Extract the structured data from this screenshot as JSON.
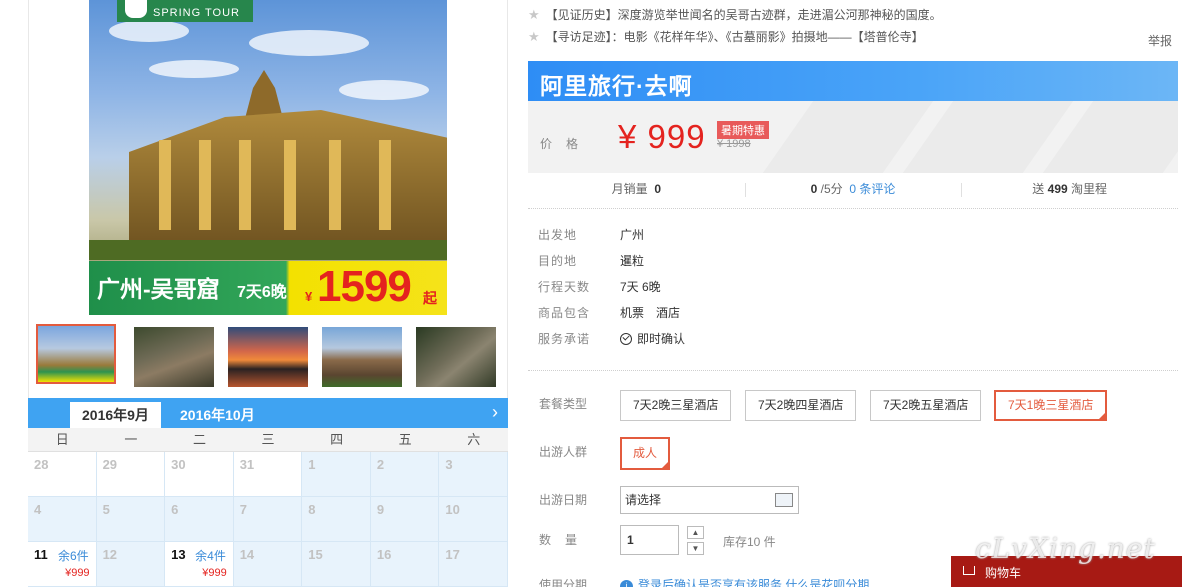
{
  "hero": {
    "logo_text": "SPRING TOUR",
    "banner_title": "广州-吴哥窟",
    "banner_sub": "7天6晚",
    "banner_yen": "¥",
    "banner_price": "1599",
    "banner_suffix": "起"
  },
  "thumbnails": [
    "thumb-1",
    "thumb-2",
    "thumb-3",
    "thumb-4",
    "thumb-5"
  ],
  "calendar": {
    "tab_current": "2016年9月",
    "tab_next": "2016年10月",
    "weekdays": [
      "日",
      "一",
      "二",
      "三",
      "四",
      "五",
      "六"
    ],
    "rows": [
      [
        {
          "d": "28"
        },
        {
          "d": "29"
        },
        {
          "d": "30"
        },
        {
          "d": "31"
        },
        {
          "d": "1"
        },
        {
          "d": "2"
        },
        {
          "d": "3"
        }
      ],
      [
        {
          "d": "4"
        },
        {
          "d": "5"
        },
        {
          "d": "6"
        },
        {
          "d": "7"
        },
        {
          "d": "8"
        },
        {
          "d": "9"
        },
        {
          "d": "10"
        }
      ],
      [
        {
          "d": "11",
          "left": "余6件",
          "price": "¥999"
        },
        {
          "d": "12"
        },
        {
          "d": "13",
          "left": "余4件",
          "price": "¥999"
        },
        {
          "d": "14"
        },
        {
          "d": "15"
        },
        {
          "d": "16"
        },
        {
          "d": "17"
        }
      ]
    ]
  },
  "highlights": [
    "【见证历史】深度游览举世闻名的吴哥古迹群，走进湄公河那神秘的国度。",
    "【寻访足迹】：电影《花样年华》、《古墓丽影》拍摄地——【塔普伦寺】"
  ],
  "report_label": "举报",
  "brand": "阿里旅行·去啊",
  "price": {
    "label": "价格",
    "current": "¥ 999",
    "tag": "暑期特惠",
    "original": "¥ 1998"
  },
  "stats": {
    "monthly_label": "月销量",
    "monthly_value": "0",
    "score_value": "0",
    "score_suffix": "/5分",
    "reviews_link": "0 条评论",
    "points_prefix": "送",
    "points_value": "499",
    "points_suffix": "淘里程"
  },
  "info": [
    {
      "k": "出发地",
      "v": "广州"
    },
    {
      "k": "目的地",
      "v": "暹粒"
    },
    {
      "k": "行程天数",
      "v": "7天 6晚"
    },
    {
      "k": "商品包含",
      "v": "机票　酒店"
    },
    {
      "k": "服务承诺",
      "v": "即时确认"
    }
  ],
  "options": {
    "package_label": "套餐类型",
    "packages": [
      "7天2晚三星酒店",
      "7天2晚四星酒店",
      "7天2晚五星酒店",
      "7天1晚三星酒店"
    ],
    "crowd_label": "出游人群",
    "crowd_value": "成人",
    "date_label": "出游日期",
    "date_placeholder": "请选择",
    "qty_label": "数　量",
    "qty_value": "1",
    "stock": "库存10 件",
    "install_label": "使用分期",
    "install_text": "登录后确认是否享有该服务 什么是花呗分期"
  },
  "cart_label": "购物车",
  "watermark": "cLvXing.net"
}
